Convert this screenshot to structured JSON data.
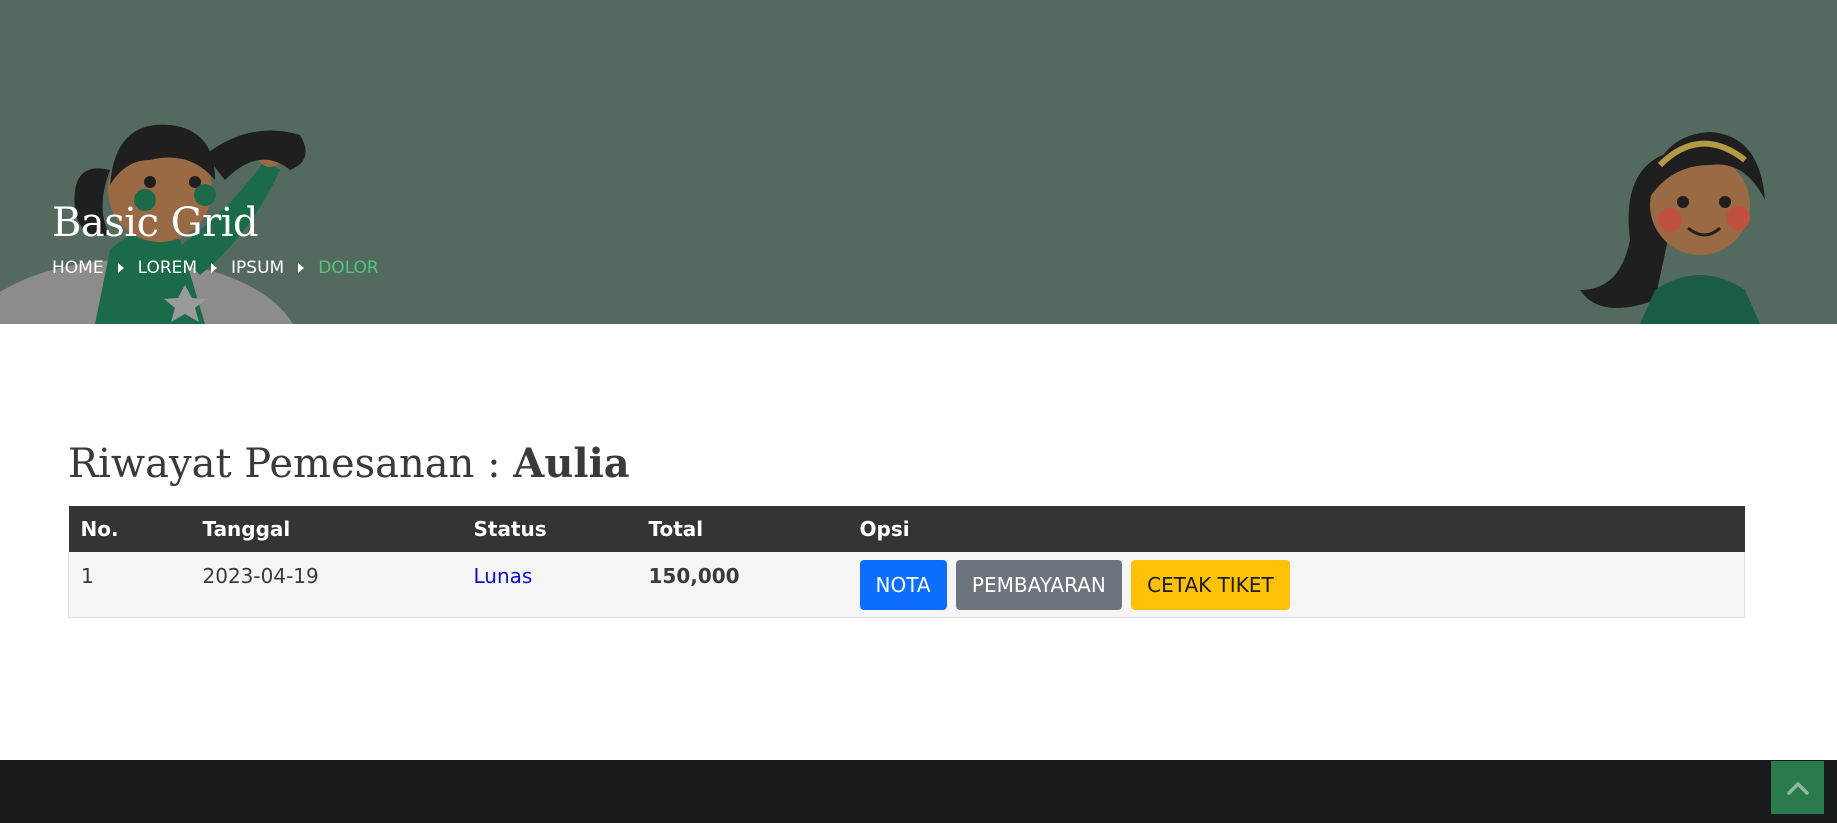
{
  "hero": {
    "title": "Basic Grid",
    "breadcrumb": [
      "HOME",
      "LOREM",
      "IPSUM",
      "DOLOR"
    ],
    "colors": {
      "background": "#546a5f",
      "active_crumb": "#4fc77c"
    },
    "illustrations": [
      "girl-waving-illustration",
      "girl-smiling-illustration"
    ]
  },
  "content": {
    "heading_prefix": "Riwayat Pemesanan : ",
    "heading_name": "Aulia"
  },
  "table": {
    "headers": [
      "No.",
      "Tanggal",
      "Status",
      "Total",
      "Opsi"
    ],
    "rows": [
      {
        "no": "1",
        "tanggal": "2023-04-19",
        "status": "Lunas",
        "total": "150,000",
        "actions": [
          "NOTA",
          "PEMBAYARAN",
          "CETAK TIKET"
        ]
      }
    ]
  },
  "footer": {
    "back_to_top_icon": "chevron-up-icon",
    "colors": {
      "background": "#18191c",
      "back_to_top": "#2b7a4e"
    }
  }
}
